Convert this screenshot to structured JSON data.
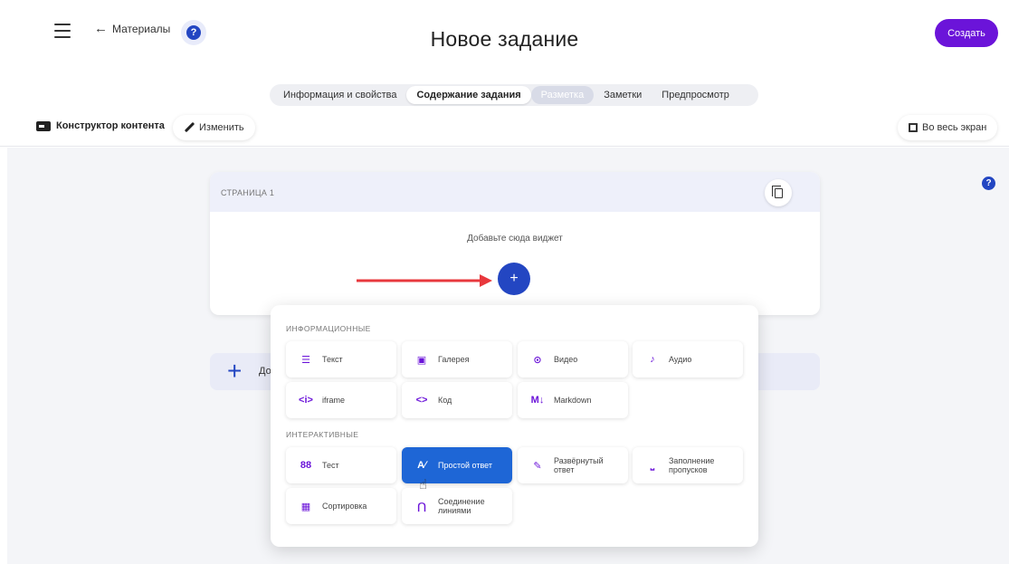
{
  "header": {
    "back_label": "Материалы",
    "help_glyph": "?",
    "title": "Новое задание",
    "create_label": "Создать",
    "accent_color": "#6b14d9"
  },
  "tabs": [
    {
      "label": "Информация и свойства",
      "state": "normal"
    },
    {
      "label": "Содержание задания",
      "state": "active"
    },
    {
      "label": "Разметка",
      "state": "disabled"
    },
    {
      "label": "Заметки",
      "state": "normal"
    },
    {
      "label": "Предпросмотр",
      "state": "normal"
    }
  ],
  "toolbar": {
    "constructor_label": "Конструктор контента",
    "edit_label": "Изменить",
    "fullscreen_label": "Во весь экран"
  },
  "canvas": {
    "help_glyph": "?",
    "page_label": "СТРАНИЦА 1",
    "add_widget_hint": "Добавьте сюда виджет",
    "add_glyph": "+",
    "add_page_partial": "До"
  },
  "widget_menu": {
    "informational_label": "ИНФОРМАЦИОННЫЕ",
    "interactive_label": "ИНТЕРАКТИВНЫЕ",
    "informational": [
      {
        "label": "Текст",
        "icon": "text-lines-icon",
        "glyph": "☰"
      },
      {
        "label": "Галерея",
        "icon": "gallery-icon",
        "glyph": "▣"
      },
      {
        "label": "Видео",
        "icon": "play-circle-icon",
        "glyph": "⊙"
      },
      {
        "label": "Аудио",
        "icon": "music-note-icon",
        "glyph": "♪"
      },
      {
        "label": "iframe",
        "icon": "iframe-icon",
        "glyph": "<i>"
      },
      {
        "label": "Код",
        "icon": "code-icon",
        "glyph": "<>"
      },
      {
        "label": "Markdown",
        "icon": "markdown-icon",
        "glyph": "M↓"
      }
    ],
    "interactive": [
      {
        "label": "Тест",
        "icon": "test-grid-icon",
        "glyph": "88"
      },
      {
        "label": "Простой ответ",
        "icon": "simple-answer-icon",
        "glyph": "A∕",
        "selected": true
      },
      {
        "label": "Развёрнутый ответ",
        "icon": "pencil-icon",
        "glyph": "✎"
      },
      {
        "label": "Заполнение пропусков",
        "icon": "blank-fill-icon",
        "glyph": "⎵"
      },
      {
        "label": "Сортировка",
        "icon": "sort-grid-icon",
        "glyph": "▦"
      },
      {
        "label": "Соединение линиями",
        "icon": "connect-lines-icon",
        "glyph": "⋂"
      }
    ],
    "selected_color": "#1e66d6"
  }
}
